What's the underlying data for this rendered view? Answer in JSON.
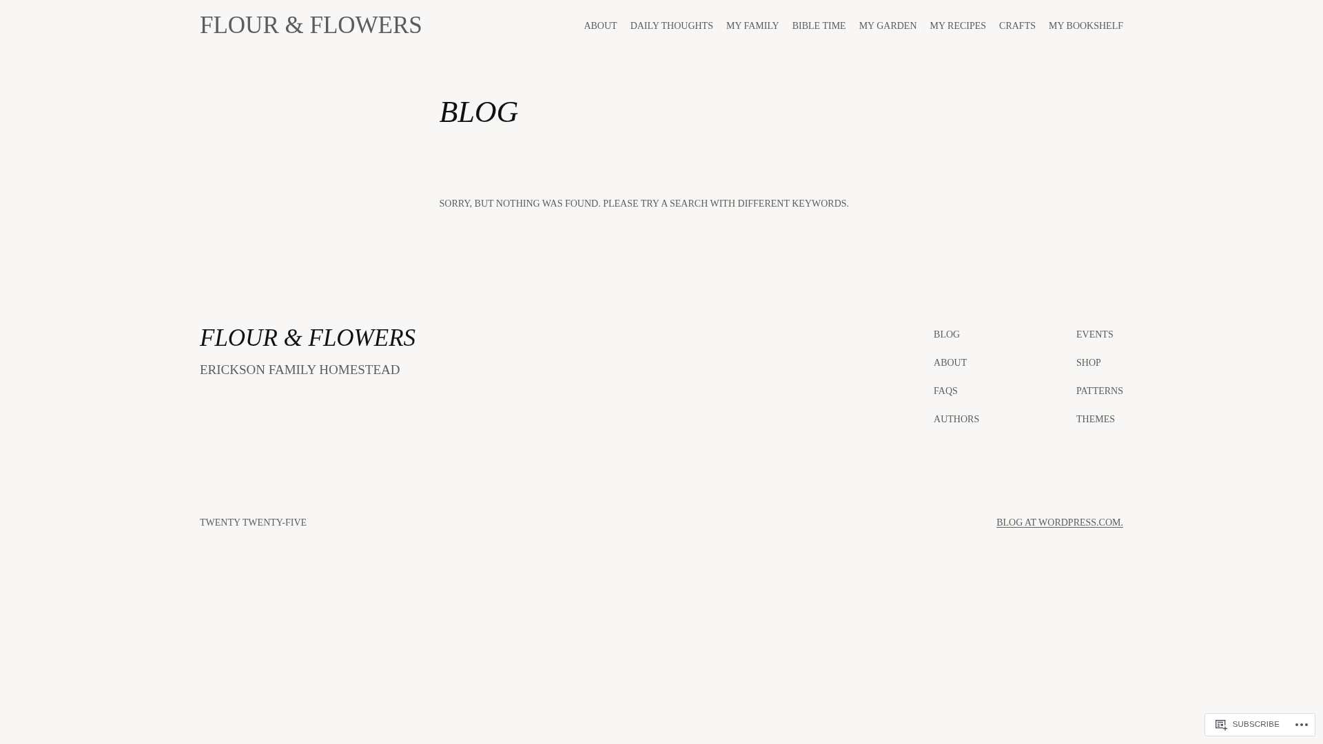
{
  "site_title": "FLOUR & FLOWERS",
  "nav": [
    "ABOUT",
    "DAILY THOUGHTS",
    "MY FAMILY",
    "BIBLE TIME",
    "MY GARDEN",
    "MY RECIPES",
    "CRAFTS",
    "MY BOOKSHELF"
  ],
  "page_title": "BLOG",
  "message": "SORRY, BUT NOTHING WAS FOUND. PLEASE TRY A SEARCH WITH DIFFERENT KEYWORDS.",
  "footer": {
    "title": "FLOUR & FLOWERS",
    "tagline": "ERICKSON FAMILY HOMESTEAD",
    "links_column_1": [
      "BLOG",
      "ABOUT",
      "FAQS",
      "AUTHORS"
    ],
    "links_column_2": [
      "EVENTS",
      "SHOP",
      "PATTERNS",
      "THEMES"
    ],
    "theme_credit": "TWENTY TWENTY-FIVE",
    "wordpress_link": "BLOG AT WORDPRESS.COM."
  },
  "subscribe_bar": {
    "label": "SUBSCRIBE"
  }
}
